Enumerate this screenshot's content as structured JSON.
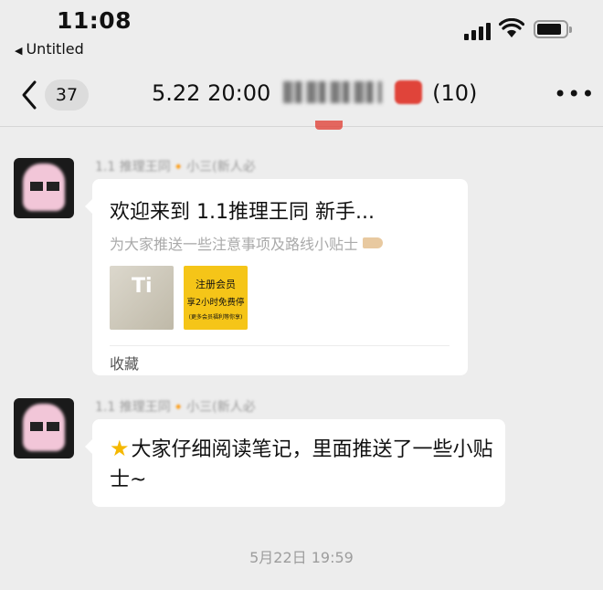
{
  "status_bar": {
    "time": "11:08",
    "back_app": "Untitled"
  },
  "nav": {
    "unread_count": "37",
    "title_prefix": "5.22 20:00",
    "title_suffix": "(10)",
    "more_icon": "more-horizontal-icon"
  },
  "messages": [
    {
      "sender": "1.1 推理王同🔸小三(新人必",
      "type": "note-card",
      "title": "欢迎来到 1.1推理王同 新手...",
      "subtitle": "为大家推送一些注意事项及路线小贴士",
      "thumb1_text": "Ti",
      "thumb2": {
        "line1": "注册会员",
        "line2": "享2小时免费停",
        "line3": "(更多会员福利等你享)"
      },
      "source": "收藏"
    },
    {
      "sender": "1.1 推理王同🔸小三(新人必",
      "type": "text",
      "text": "大家仔细阅读笔记，里面推送了一些小贴士~"
    }
  ],
  "timestamp": "5月22日 19:59",
  "colors": {
    "background": "#ededed",
    "bubble": "#ffffff",
    "thumb_yellow": "#f5c518"
  }
}
